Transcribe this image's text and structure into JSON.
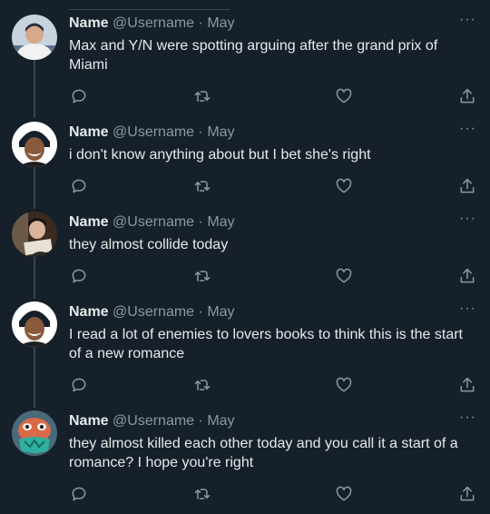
{
  "tweets": [
    {
      "name": "Name",
      "handle": "@Username",
      "dot": "·",
      "date": "May",
      "more": "···",
      "text": "Max and Y/N were spotting arguing after the grand prix of Miami",
      "avatar": "avatar-white-shirt"
    },
    {
      "name": "Name",
      "handle": "@Username",
      "dot": "·",
      "date": "May",
      "more": "···",
      "text": "i don't know anything about but I bet she's right",
      "avatar": "avatar-smiling-hat"
    },
    {
      "name": "Name",
      "handle": "@Username",
      "dot": "·",
      "date": "May",
      "more": "···",
      "text": "they almost collide today",
      "avatar": "avatar-reading"
    },
    {
      "name": "Name",
      "handle": "@Username",
      "dot": "·",
      "date": "May",
      "more": "···",
      "text": "I read a lot of enemies to lovers books to think this is the start of a new romance",
      "avatar": "avatar-smiling-hat"
    },
    {
      "name": "Name",
      "handle": "@Username",
      "dot": "·",
      "date": "May",
      "more": "···",
      "text": "they almost killed each other today and you call it a start of a romance? I hope you're right",
      "avatar": "avatar-cartoon-bird"
    }
  ],
  "colors": {
    "background": "#15202b",
    "text": "#e7e9ea",
    "secondary": "#8b98a5",
    "divider": "#38444d"
  },
  "icons": [
    "reply-icon",
    "retweet-icon",
    "like-icon",
    "share-icon",
    "more-icon"
  ]
}
